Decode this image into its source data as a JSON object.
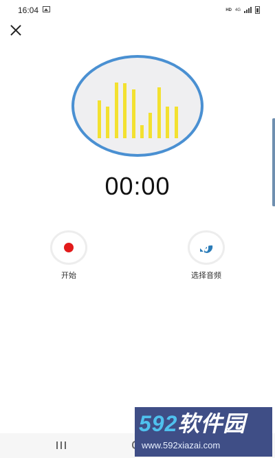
{
  "status_bar": {
    "time": "16:04",
    "hd_label": "HD",
    "network_label": "4G",
    "icons": [
      "gallery-icon",
      "signal-icon",
      "battery-icon"
    ]
  },
  "header": {
    "close_icon": "close-icon"
  },
  "visualizer": {
    "icon": "sound-wave-icon",
    "bar_color": "#f3e130",
    "ring_color": "#4a90d2",
    "levels": [
      0.66,
      0.55,
      0.97,
      0.95,
      0.84,
      0.23,
      0.44,
      0.88,
      0.55,
      0.55
    ]
  },
  "timer": {
    "value": "00:00"
  },
  "actions": {
    "start": {
      "label": "开始",
      "icon": "record-icon",
      "color": "#e21b1b"
    },
    "select_audio": {
      "label": "选择音频",
      "icon": "music-note-icon",
      "color": "#2b7cb8"
    }
  },
  "nav_bar": {
    "icons": [
      "recent-apps-icon",
      "home-icon",
      "back-icon"
    ]
  },
  "watermark": {
    "logo_number": "592",
    "logo_text": "软件园",
    "url": "www.592xiazai.com"
  }
}
